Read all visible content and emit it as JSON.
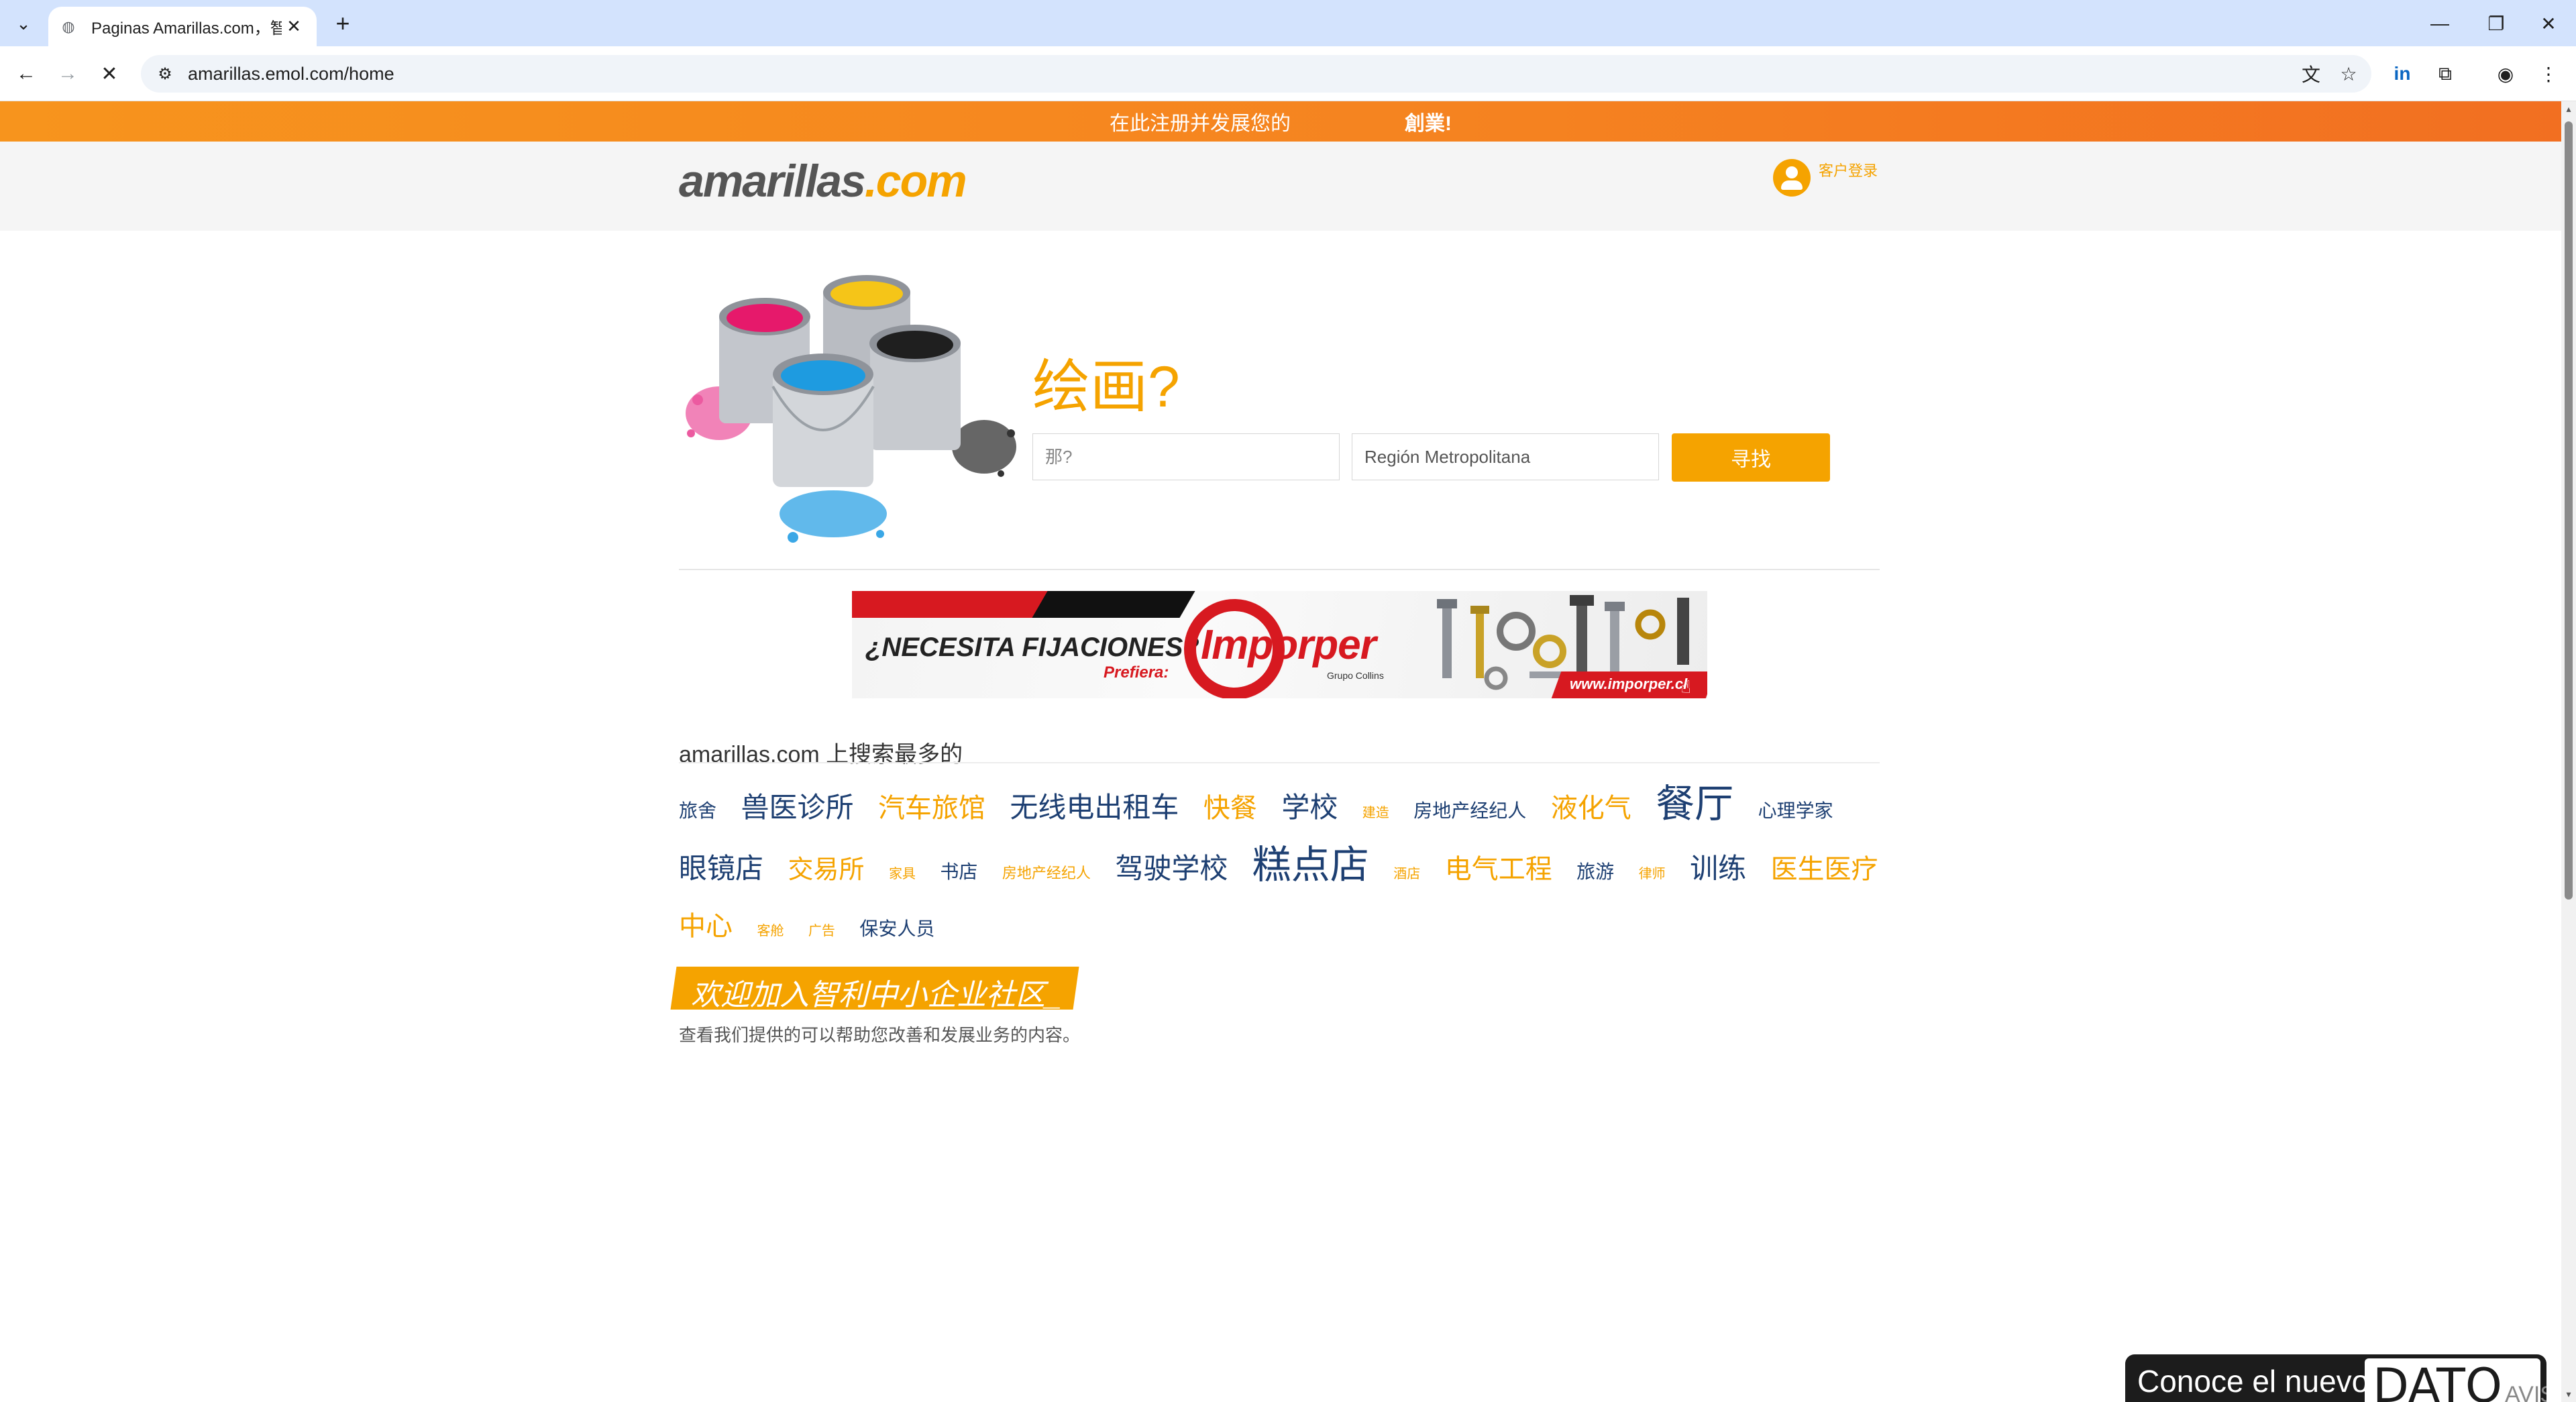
{
  "browser": {
    "tab_title": "Paginas Amarillas.com，智利",
    "url": "amarillas.emol.com/home"
  },
  "promo": {
    "text": "在此注册并发展您的",
    "strong": "創業!"
  },
  "header": {
    "logo_main": "amarillas",
    "logo_tld": ".com",
    "login_label": "客户登录"
  },
  "hero": {
    "title": "绘画?",
    "what_placeholder": "那?",
    "where_value": "Región Metropolitana",
    "search_button": "寻找"
  },
  "ad": {
    "headline": "¿NECESITA FIJACIONES?",
    "prefiera": "Prefiera:",
    "brand": "Imporper",
    "group": "Grupo Collins",
    "url": "www.imporper.cl"
  },
  "popular": {
    "title": "amarillas.com 上搜索最多的",
    "tags": [
      {
        "label": "旅舍",
        "color": "navy",
        "size": 28
      },
      {
        "label": "兽医诊所",
        "color": "navy",
        "size": 42
      },
      {
        "label": "汽车旅馆",
        "color": "orange",
        "size": 40
      },
      {
        "label": "无线电出租车",
        "color": "navy",
        "size": 42
      },
      {
        "label": "快餐",
        "color": "orange",
        "size": 40
      },
      {
        "label": "学校",
        "color": "navy",
        "size": 42
      },
      {
        "label": "建造",
        "color": "orange",
        "size": 20
      },
      {
        "label": "房地产经纪人",
        "color": "navy",
        "size": 28
      },
      {
        "label": "液化气",
        "color": "orange",
        "size": 40
      },
      {
        "label": "餐厅",
        "color": "navy",
        "size": 58
      },
      {
        "label": "心理学家",
        "color": "navy",
        "size": 28
      },
      {
        "label": "眼镜店",
        "color": "navy",
        "size": 42
      },
      {
        "label": "交易所",
        "color": "orange",
        "size": 38
      },
      {
        "label": "家具",
        "color": "orange",
        "size": 20
      },
      {
        "label": "书店",
        "color": "navy",
        "size": 28
      },
      {
        "label": "房地产经纪人",
        "color": "orange",
        "size": 22
      },
      {
        "label": "驾驶学校",
        "color": "navy",
        "size": 42
      },
      {
        "label": "糕点店",
        "color": "navy",
        "size": 58
      },
      {
        "label": "酒店",
        "color": "orange",
        "size": 20
      },
      {
        "label": "电气工程",
        "color": "orange",
        "size": 40
      },
      {
        "label": "旅游",
        "color": "navy",
        "size": 28
      },
      {
        "label": "律师",
        "color": "orange",
        "size": 20
      },
      {
        "label": "训练",
        "color": "navy",
        "size": 42
      },
      {
        "label": "医生医疗中心",
        "color": "orange",
        "size": 40
      },
      {
        "label": "客舱",
        "color": "orange",
        "size": 20
      },
      {
        "label": "广告",
        "color": "orange",
        "size": 20
      },
      {
        "label": "保安人员",
        "color": "navy",
        "size": 28
      }
    ]
  },
  "community": {
    "title": "欢迎加入智利中小企业社区_",
    "description": "查看我们提供的可以帮助您改善和发展业务的内容。"
  },
  "widget": {
    "text": "Conoce el nuevo",
    "logo_big": "DATO",
    "logo_small": "AVISOS"
  },
  "colors": {
    "accent_orange": "#f5a300",
    "promo_orange": "#f58220",
    "navy": "#1d3f72",
    "tab_strip": "#d3e3fd"
  },
  "icons": [
    "chevron-down-icon",
    "globe-icon",
    "close-icon",
    "plus-icon",
    "minimize-icon",
    "restore-icon",
    "back-icon",
    "forward-icon",
    "stop-icon",
    "site-info-icon",
    "translate-icon",
    "star-icon",
    "linkedin-icon",
    "extensions-icon",
    "profile-icon",
    "menu-icon",
    "user-icon"
  ]
}
